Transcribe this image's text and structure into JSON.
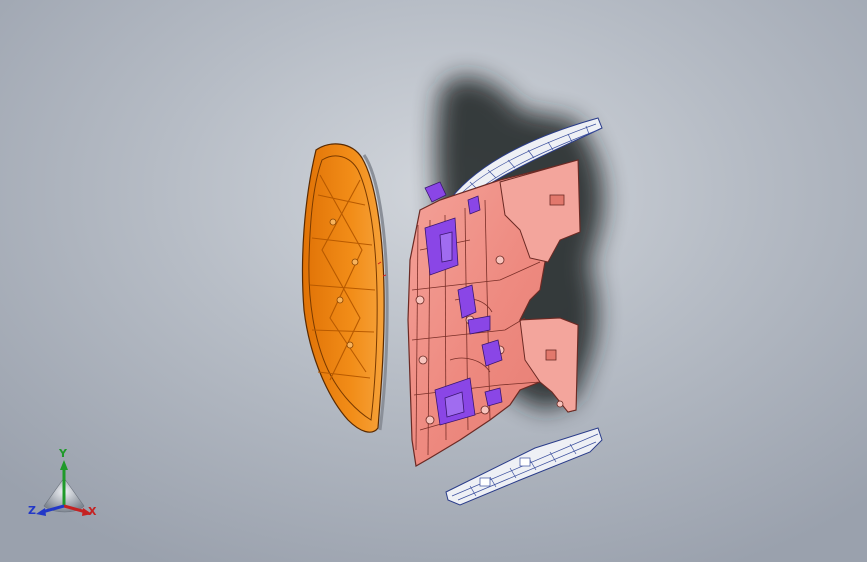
{
  "window": {
    "title": ""
  },
  "viewport": {
    "background_top": "#d2d6dc",
    "background_bottom": "#9aa1ad"
  },
  "model_parts": [
    {
      "name": "cover-panel",
      "color": "#f08a14"
    },
    {
      "name": "main-panel",
      "color": "#f08e86"
    },
    {
      "name": "insert-features",
      "color": "#8a46e6"
    },
    {
      "name": "upper-bracket",
      "color": "#eef0f5"
    },
    {
      "name": "lower-bracket",
      "color": "#eef0f5"
    }
  ],
  "triad": {
    "icon": "coordinate-triad-icon",
    "labels": {
      "x": "X",
      "y": "Y",
      "z": "Z"
    },
    "colors": {
      "x": "#c52222",
      "y": "#1f9a2a",
      "z": "#2238c8"
    }
  }
}
